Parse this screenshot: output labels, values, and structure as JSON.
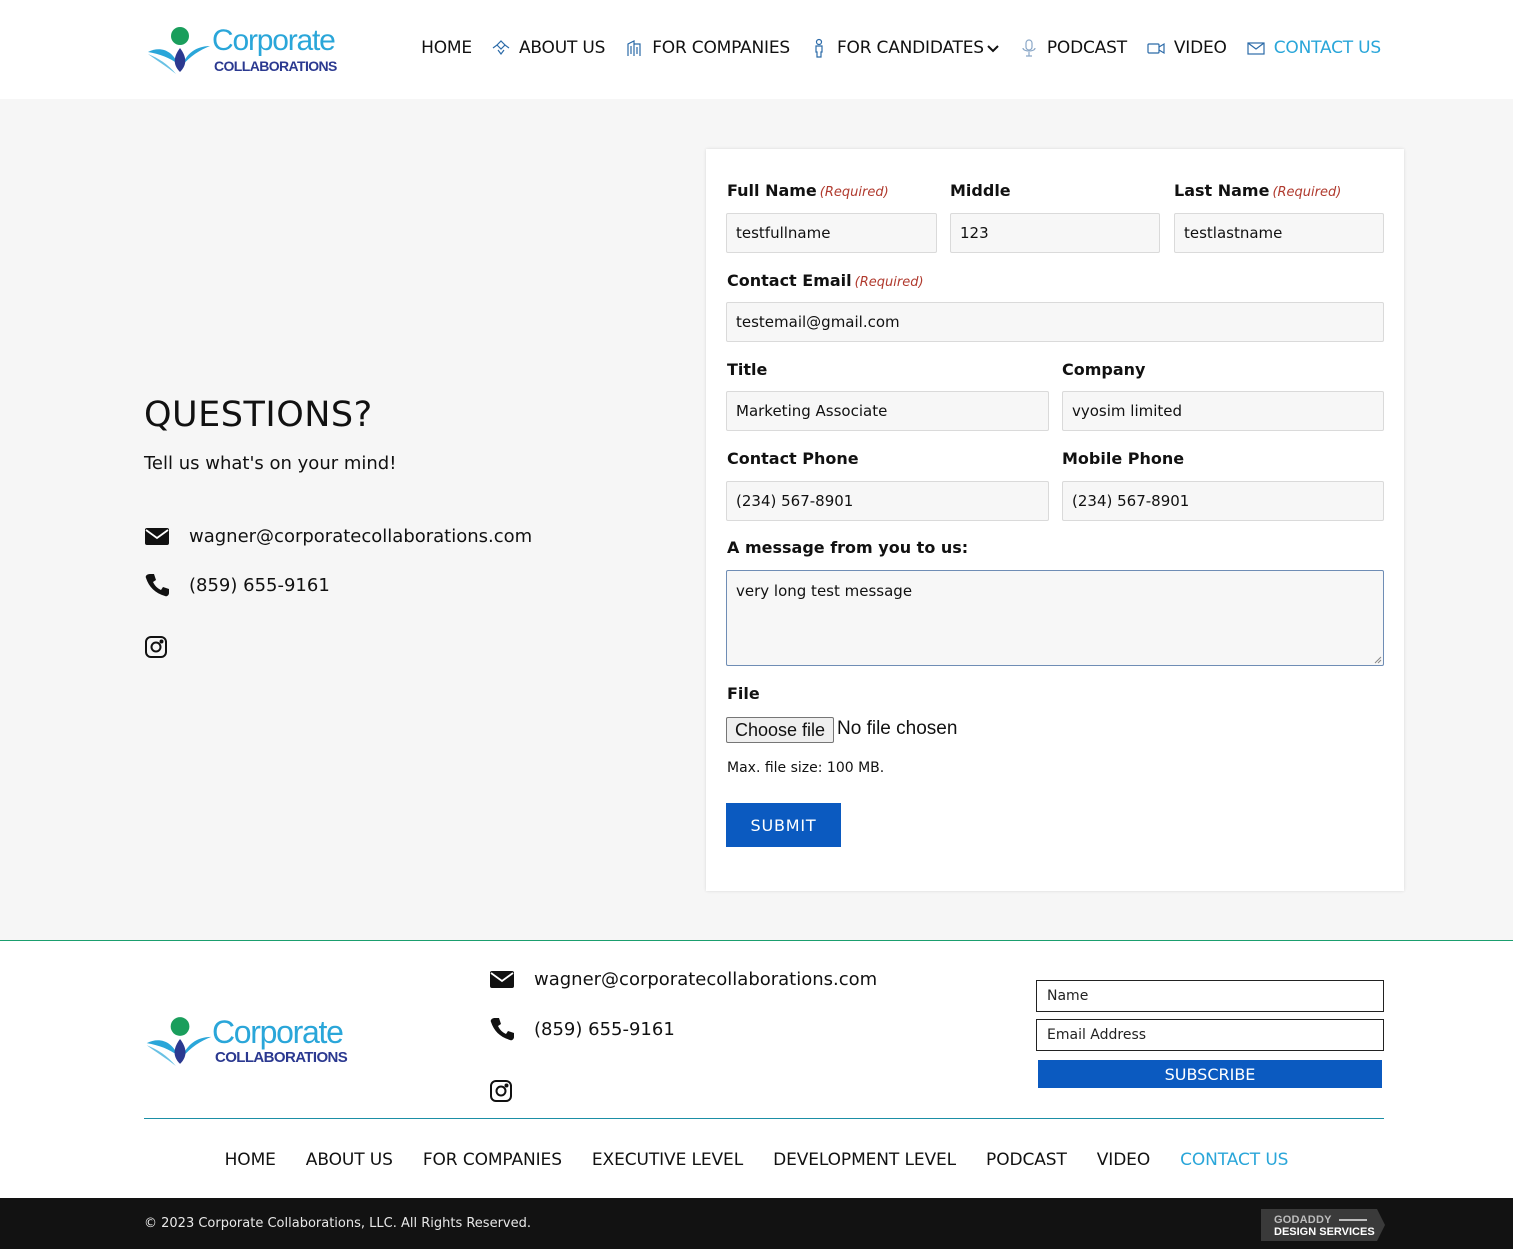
{
  "brand": {
    "word1": "Corporate",
    "word2": "COLLABORATIONS"
  },
  "nav": {
    "items": [
      {
        "label": "HOME",
        "icon": ""
      },
      {
        "label": "ABOUT US",
        "icon": "handshake-icon"
      },
      {
        "label": "FOR COMPANIES",
        "icon": "building-icon"
      },
      {
        "label": "FOR CANDIDATES",
        "icon": "person-icon"
      },
      {
        "label": "PODCAST",
        "icon": "microphone-icon"
      },
      {
        "label": "VIDEO",
        "icon": "video-camera-icon"
      },
      {
        "label": "CONTACT US",
        "icon": "envelope-icon"
      }
    ],
    "active_index": 6,
    "active_color": "#2aa6d9"
  },
  "intro": {
    "heading": "QUESTIONS?",
    "tagline": "Tell us what's on your mind!",
    "email": "wagner@corporatecollaborations.com",
    "phone": "(859) 655-9161"
  },
  "form": {
    "required_text": "(Required)",
    "full_name": {
      "label": "Full Name",
      "value": "testfullname"
    },
    "middle": {
      "label": "Middle",
      "value": "123"
    },
    "last_name": {
      "label": "Last Name",
      "value": "testlastname"
    },
    "email": {
      "label": "Contact Email",
      "value": "testemail@gmail.com"
    },
    "title": {
      "label": "Title",
      "value": "Marketing Associate"
    },
    "company": {
      "label": "Company",
      "value": "vyosim limited"
    },
    "contact_phone": {
      "label": "Contact Phone",
      "value": "(234) 567-8901"
    },
    "mobile_phone": {
      "label": "Mobile Phone",
      "value": "(234) 567-8901"
    },
    "message": {
      "label": "A message from you to us:",
      "value": "very long test message"
    },
    "file": {
      "label": "File",
      "button": "Choose file",
      "status": "No file chosen",
      "note": "Max. file size: 100 MB."
    },
    "submit": "SUBMIT",
    "button_color": "#0b5ac0"
  },
  "footer": {
    "email": "wagner@corporatecollaborations.com",
    "phone": "(859) 655-9161",
    "name_placeholder": "Name",
    "email_placeholder": "Email Address",
    "subscribe": "SUBSCRIBE",
    "nav": [
      "HOME",
      "ABOUT US",
      "FOR COMPANIES",
      "EXECUTIVE LEVEL",
      "DEVELOPMENT LEVEL",
      "PODCAST",
      "VIDEO",
      "CONTACT US"
    ],
    "nav_active_index": 7,
    "copyright": "© 2023 Corporate Collaborations, LLC. All Rights Reserved.",
    "badge_line1": "GODADDY",
    "badge_line2": "DESIGN SERVICES"
  }
}
